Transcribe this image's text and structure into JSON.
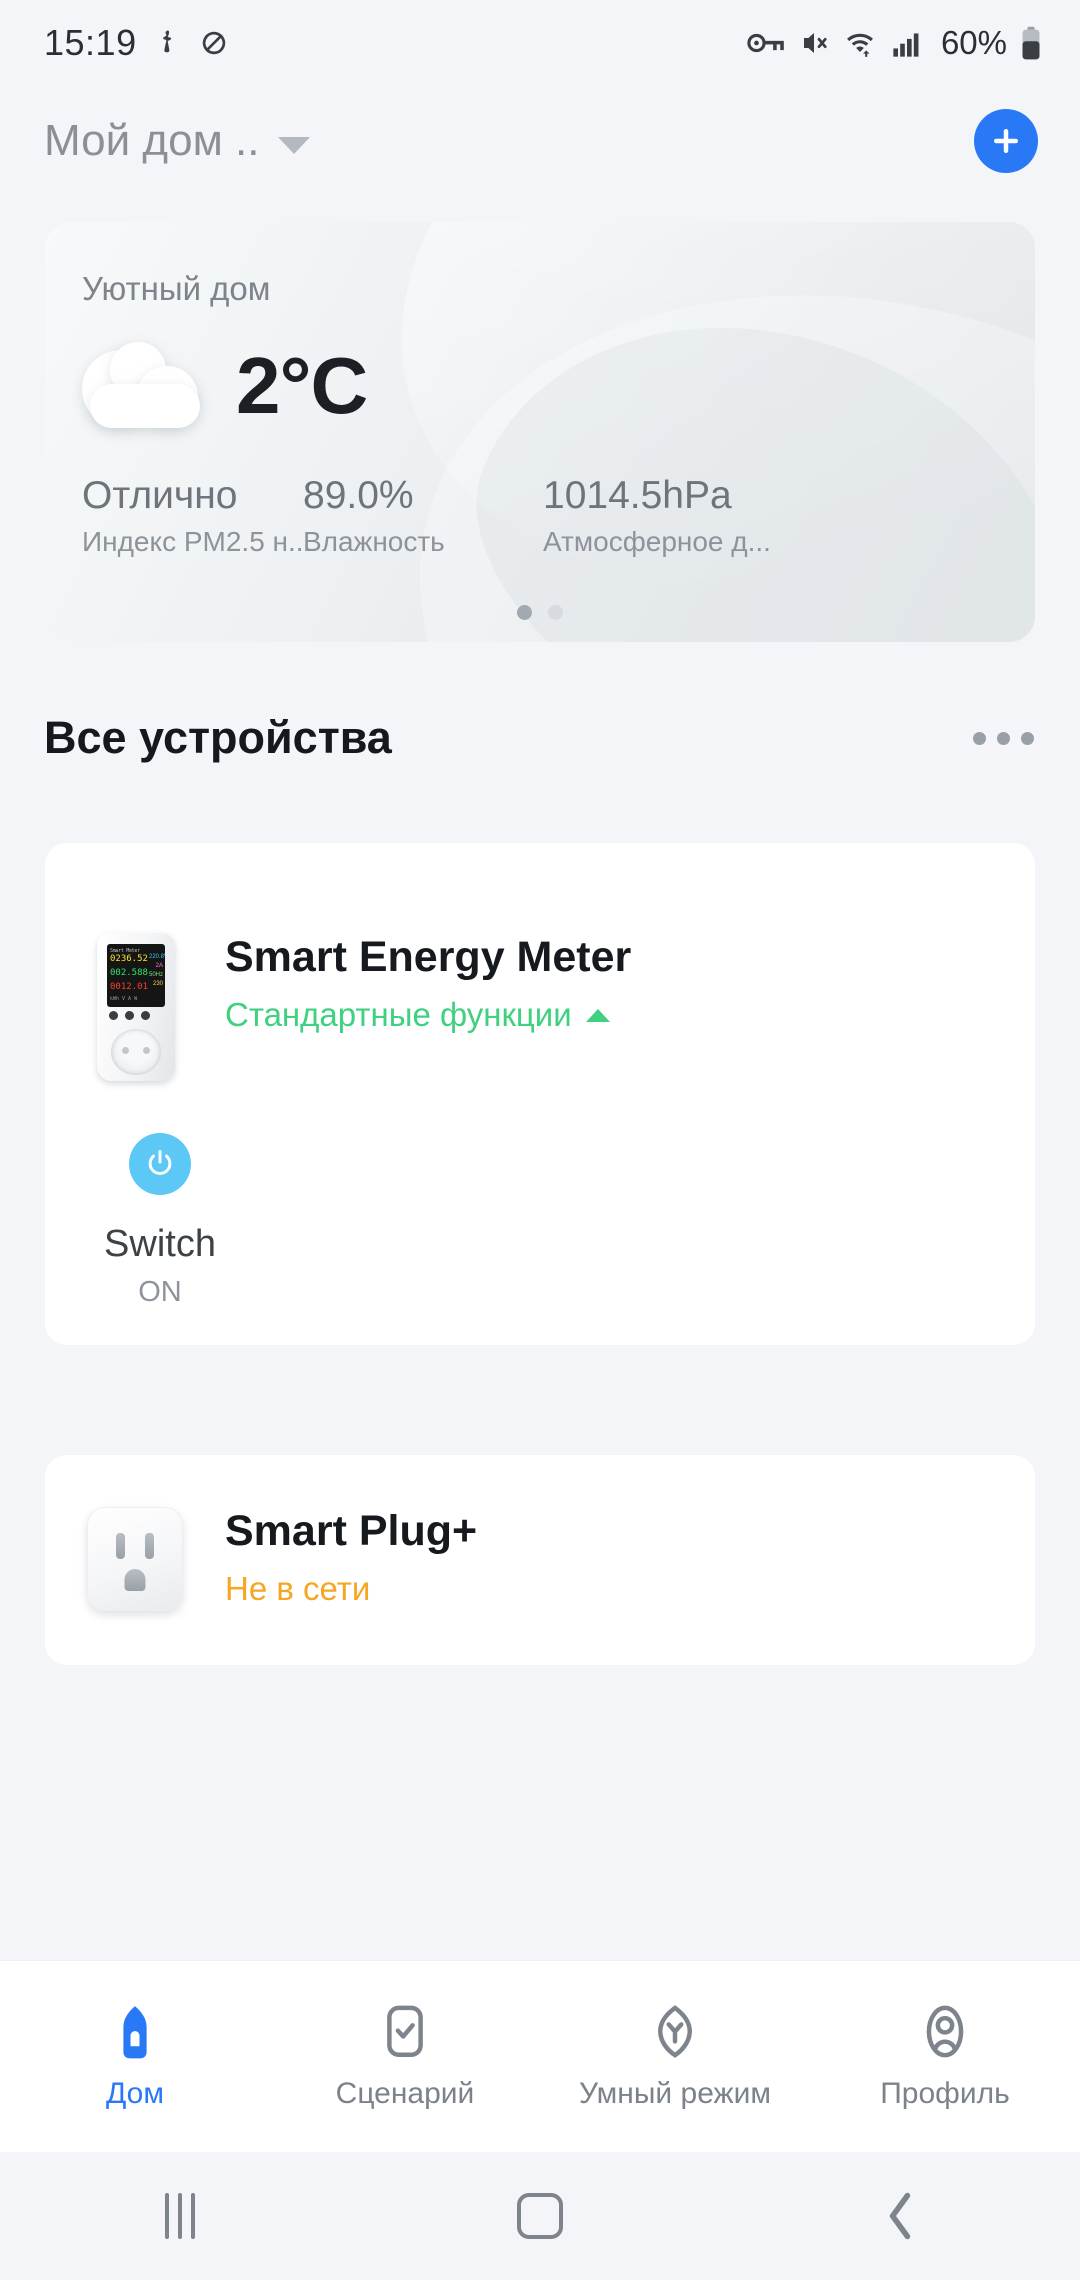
{
  "statusbar": {
    "time": "15:19",
    "battery_text": "60%",
    "icons": [
      "location-icon",
      "do-not-disturb-icon",
      "vpn-key-icon",
      "mute-icon",
      "wifi-icon",
      "signal-icon",
      "battery-icon"
    ]
  },
  "header": {
    "home_name": "Мой дом ..",
    "add_label": "+"
  },
  "weather": {
    "room": "Уютный дом",
    "temperature": "2°C",
    "condition_icon": "cloud-icon",
    "stats": [
      {
        "value": "Отлично",
        "label": "Индекс PM2.5 н..."
      },
      {
        "value": "89.0%",
        "label": "Влажность"
      },
      {
        "value": "1014.5hPa",
        "label": "Атмосферное д..."
      }
    ],
    "page_dots": 2,
    "active_dot": 0
  },
  "devices_section": {
    "title": "Все устройства",
    "menu_label": "more-options"
  },
  "devices": [
    {
      "name": "Smart Energy Meter",
      "status": "Стандартные функции",
      "status_color": "#3fd17f",
      "thumbnail": "energy-meter-image",
      "meter_screen": {
        "header": "Smart Meter",
        "row1": "0236.52",
        "row2": "002.588",
        "row3": "0012.01",
        "row4": "kWh  V  A  W",
        "side": [
          "220.8V",
          "2A",
          "50Hz",
          "230"
        ]
      },
      "control": {
        "icon": "power-icon",
        "label": "Switch",
        "state": "ON"
      }
    },
    {
      "name": "Smart Plug+",
      "status": "Не в сети",
      "status_color": "#f5a623",
      "thumbnail": "smart-plug-image"
    }
  ],
  "bottom_nav": [
    {
      "label": "Дом",
      "icon": "home-icon",
      "active": true
    },
    {
      "label": "Сценарий",
      "icon": "scene-check-icon",
      "active": false
    },
    {
      "label": "Умный режим",
      "icon": "smart-mode-icon",
      "active": false
    },
    {
      "label": "Профиль",
      "icon": "profile-icon",
      "active": false
    }
  ],
  "android_nav": {
    "recents": "recents-icon",
    "home": "home-square-icon",
    "back": "back-icon"
  },
  "colors": {
    "accent": "#2979f6",
    "online": "#3fd17f",
    "offline": "#f5a623",
    "switch": "#5bc8f5",
    "background": "#f3f5f8"
  }
}
